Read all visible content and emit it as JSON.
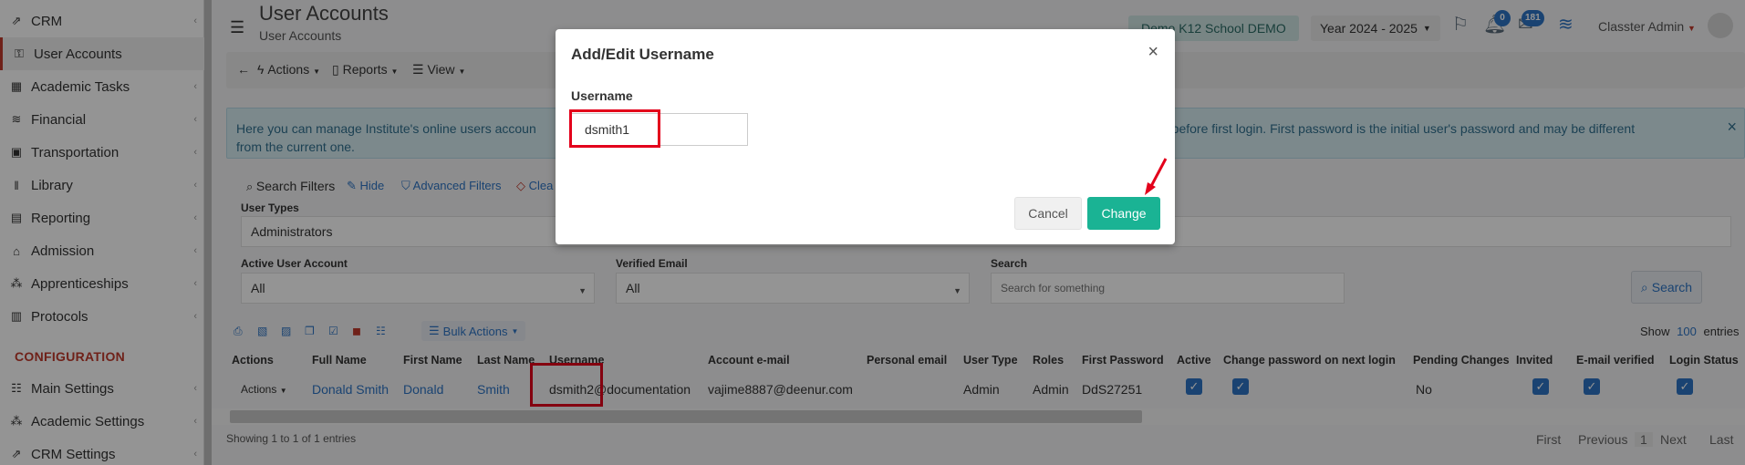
{
  "sidebar": {
    "items": [
      {
        "label": "CRM",
        "icon": "crm-icon",
        "glyph": "⇗"
      },
      {
        "label": "User Accounts",
        "icon": "key-icon",
        "glyph": "⚿"
      },
      {
        "label": "Academic Tasks",
        "icon": "grid-icon",
        "glyph": "▦"
      },
      {
        "label": "Financial",
        "icon": "coins-icon",
        "glyph": "≋"
      },
      {
        "label": "Transportation",
        "icon": "bus-icon",
        "glyph": "▣"
      },
      {
        "label": "Library",
        "icon": "library-icon",
        "glyph": "‖"
      },
      {
        "label": "Reporting",
        "icon": "print-icon",
        "glyph": "▤"
      },
      {
        "label": "Admission",
        "icon": "bank-icon",
        "glyph": "⌂"
      },
      {
        "label": "Apprenticeships",
        "icon": "network-icon",
        "glyph": "⁂"
      },
      {
        "label": "Protocols",
        "icon": "protocol-icon",
        "glyph": "▥"
      }
    ],
    "config_header": "CONFIGURATION",
    "config_items": [
      {
        "label": "Main Settings",
        "icon": "sliders-icon",
        "glyph": "☷"
      },
      {
        "label": "Academic Settings",
        "icon": "network-icon",
        "glyph": "⁂"
      },
      {
        "label": "CRM Settings",
        "icon": "crm-icon",
        "glyph": "⇗"
      }
    ]
  },
  "header": {
    "title": "User Accounts",
    "subtitle": "User Accounts",
    "school": "Demo K12 School DEMO",
    "year": "Year 2024 - 2025",
    "notif_badge": "0",
    "mail_badge": "181",
    "user": "Classter Admin"
  },
  "action_bar": {
    "back": "←",
    "actions": "Actions",
    "reports": "Reports",
    "view": "View"
  },
  "info": {
    "line1_left": "Here you can manage Institute's online users accoun",
    "line1_right": "nail before first login. First password is the initial user's password and may be different",
    "line2": "from the current one.",
    "close": "×"
  },
  "filters": {
    "search_filters": "Search Filters",
    "hide": "Hide",
    "advanced": "Advanced Filters",
    "clear": "Clea",
    "user_types_label": "User Types",
    "user_types_value": "Administrators",
    "active_label": "Active User Account",
    "active_value": "All",
    "verified_label": "Verified Email",
    "verified_value": "All",
    "search_label": "Search",
    "search_placeholder": "Search for something",
    "search_button": "Search"
  },
  "toolbar": {
    "bulk_actions": "Bulk Actions",
    "show": "Show",
    "show_count": "100",
    "entries": "entries"
  },
  "table": {
    "headers": [
      "Actions",
      "Full Name",
      "First Name",
      "Last Name",
      "Username",
      "Account e-mail",
      "Personal email",
      "User Type",
      "Roles",
      "First Password",
      "Active",
      "Change password on next login",
      "Pending Changes",
      "Invited",
      "E-mail verified",
      "Login Status"
    ],
    "row": {
      "actions": "Actions",
      "full_name": "Donald Smith",
      "first_name": "Donald",
      "last_name": "Smith",
      "username": "dsmith2@documentation",
      "account_email": "vajime8887@deenur.com",
      "personal_email": "",
      "user_type": "Admin",
      "roles": "Admin",
      "first_password": "DdS27251",
      "pending": "No"
    },
    "showing": "Showing 1 to 1 of 1 entries",
    "pager": [
      "First",
      "Previous",
      "1",
      "Next",
      "Last"
    ]
  },
  "modal": {
    "title": "Add/Edit Username",
    "close": "×",
    "label": "Username",
    "value": "dsmith1",
    "cancel": "Cancel",
    "change": "Change"
  },
  "colors": {
    "accent": "#1ab394",
    "link": "#2d74c4",
    "highlight": "#e3001b",
    "config_header": "#c0392b"
  }
}
